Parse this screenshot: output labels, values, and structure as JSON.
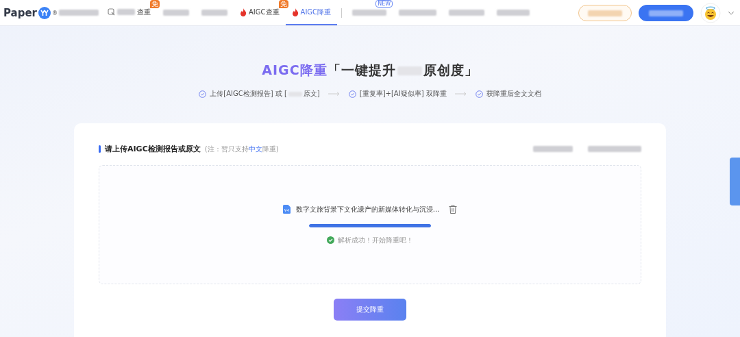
{
  "header": {
    "logo": "Paper",
    "logo_mark": "®",
    "nav": [
      {
        "kind": "search",
        "label": "查重",
        "badge": "免",
        "selected": false
      },
      {
        "kind": "flame",
        "label": "AIGC查重",
        "badge": "免",
        "selected": false
      },
      {
        "kind": "flame",
        "label": "AIGC降重",
        "selected": true
      }
    ],
    "new_badge": "NEW"
  },
  "hero": {
    "title_accent": "AIGC降重",
    "title_start": "「一键提升",
    "title_end": "原创度」",
    "steps": [
      {
        "parts": [
          "上传[AIGC检测报告] 或 [",
          "原文]"
        ]
      },
      {
        "parts": [
          "[重复率]+[AI疑似率] 双降重"
        ]
      },
      {
        "parts": [
          "获降重后全文文档"
        ]
      }
    ]
  },
  "upload": {
    "heading": "请上传AIGC检测报告或原文",
    "note_before": "(注：暂只支持",
    "note_highlight": "中文",
    "note_after": "降重)",
    "file": {
      "name": "数字文旅背景下文化遗产的新媒体转化与沉浸...",
      "level": 1,
      "status": "解析成功！开始降重吧！"
    },
    "submit": "提交降重"
  }
}
